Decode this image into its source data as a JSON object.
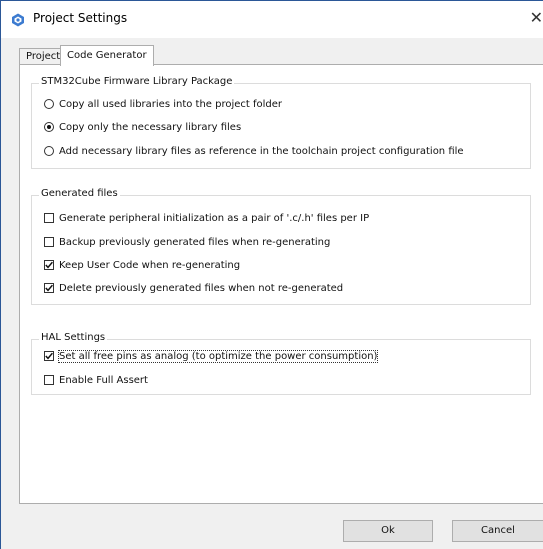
{
  "window": {
    "title": "Project Settings",
    "close_glyph": "✕"
  },
  "tabs": [
    {
      "label": "Project",
      "selected": false
    },
    {
      "label": "Code Generator",
      "selected": true
    }
  ],
  "firmware_group": {
    "title": "STM32Cube Firmware Library Package",
    "options": [
      {
        "label": "Copy all used libraries into the project folder",
        "checked": false
      },
      {
        "label": "Copy only the necessary library files",
        "checked": true
      },
      {
        "label": "Add necessary library files as reference in the toolchain project configuration file",
        "checked": false
      }
    ]
  },
  "generated_group": {
    "title": "Generated files",
    "options": [
      {
        "label": "Generate peripheral initialization as a pair of '.c/.h' files per IP",
        "checked": false
      },
      {
        "label": "Backup previously generated files when re-generating",
        "checked": false
      },
      {
        "label": "Keep User Code when re-generating",
        "checked": true
      },
      {
        "label": "Delete previously generated files when not re-generated",
        "checked": true
      }
    ]
  },
  "hal_group": {
    "title": "HAL Settings",
    "options": [
      {
        "label": "Set all free pins as analog (to optimize the power consumption)",
        "checked": true
      },
      {
        "label": "Enable Full Assert",
        "checked": false
      }
    ]
  },
  "buttons": {
    "ok": "Ok",
    "cancel": "Cancel"
  },
  "colors": {
    "accent": "#2b5797",
    "panel": "#ffffff",
    "background": "#f0f0f0"
  },
  "icons": {
    "app": "stm32cube-app-icon",
    "close": "close-icon",
    "check": "checkmark-icon"
  }
}
